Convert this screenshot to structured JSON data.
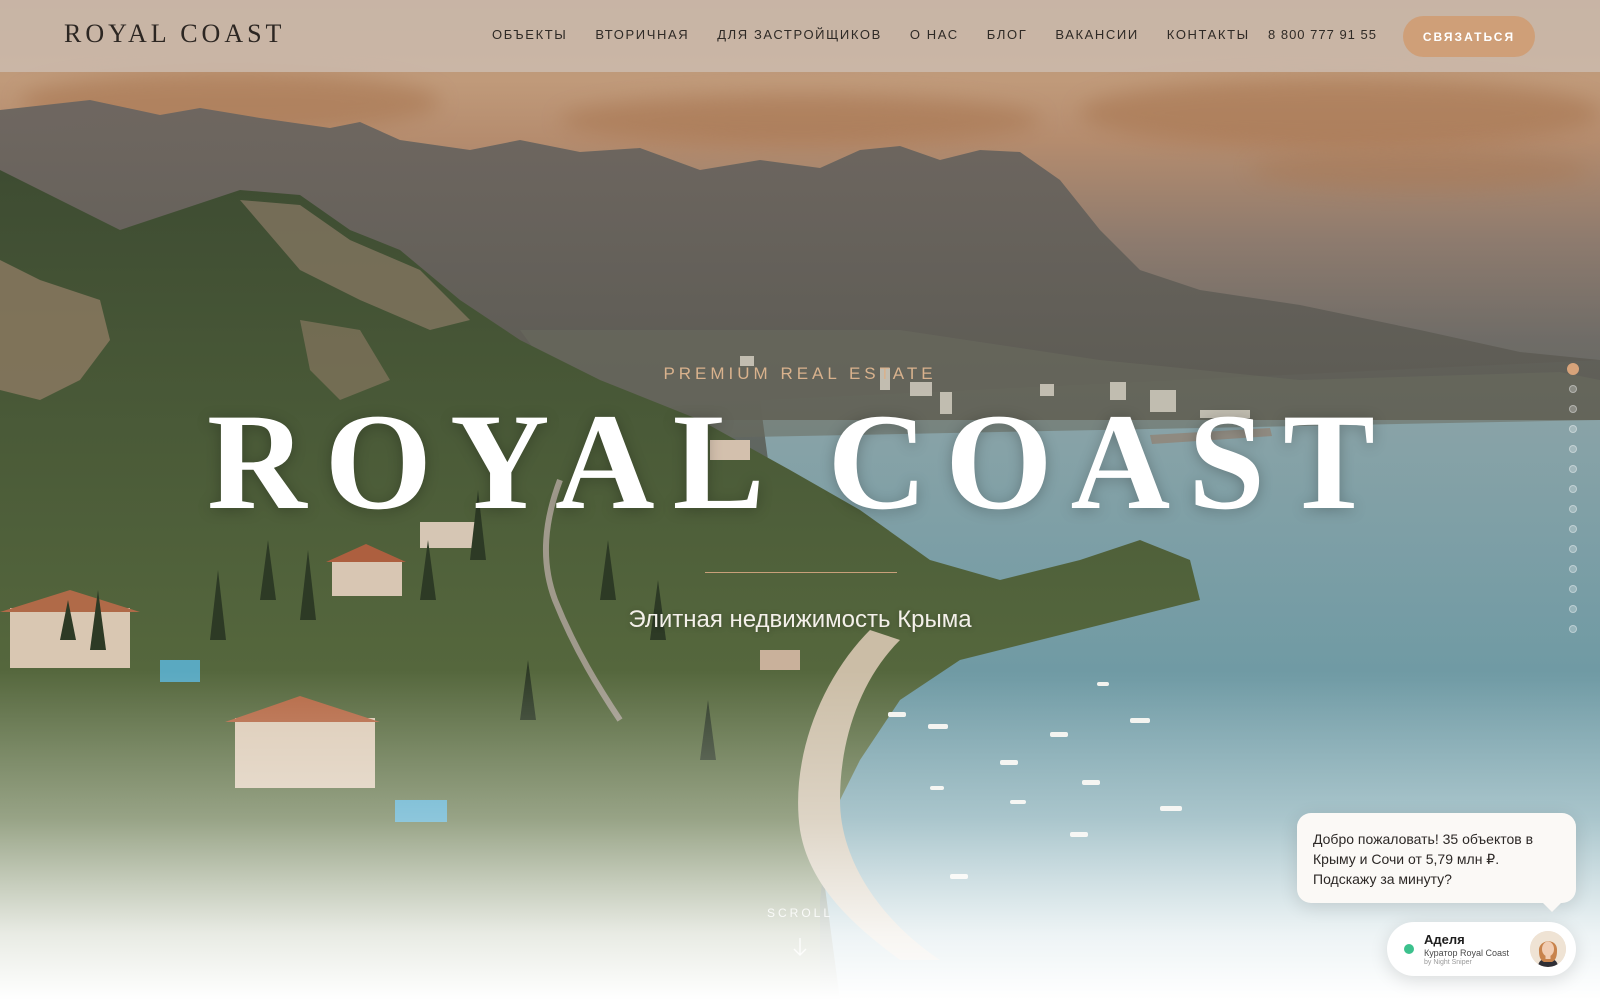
{
  "header": {
    "logo": "ROYAL COAST",
    "nav": [
      "ОБЪЕКТЫ",
      "ВТОРИЧНАЯ",
      "ДЛЯ ЗАСТРОЙЩИКОВ",
      "О НАС",
      "БЛОГ",
      "ВАКАНСИИ",
      "КОНТАКТЫ"
    ],
    "phone": "8 800 777 91 55",
    "cta": "СВЯЗАТЬСЯ"
  },
  "hero": {
    "kicker": "PREMIUM REAL ESTATE",
    "title": "ROYAL COAST",
    "subtitle": "Элитная недвижимость Крыма",
    "scroll_label": "SCROLL"
  },
  "pagination": {
    "total": 14,
    "active_index": 0
  },
  "chat": {
    "message": "Добро пожаловать! 35 объектов в Крыму и Сочи от 5,79 млн ₽. Подскажу за минуту?",
    "agent_name": "Аделя",
    "agent_role": "Куратор Royal Coast",
    "powered_by": "by Night Sniper",
    "status": "online"
  },
  "colors": {
    "accent": "#cf9f78",
    "kicker": "#d9b28d",
    "online": "#3cc18d"
  },
  "icons": {
    "scroll": "arrow-down-icon",
    "status": "online-dot-icon"
  }
}
